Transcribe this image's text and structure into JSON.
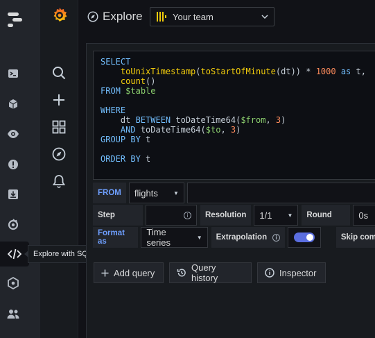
{
  "header": {
    "title": "Explore",
    "team_select": "Your team"
  },
  "tooltip": {
    "text": "Explore with SQL"
  },
  "editor": {
    "lines": [
      [
        {
          "t": "SELECT",
          "c": "kw"
        }
      ],
      [
        {
          "t": "    "
        },
        {
          "t": "toUnixTimestamp",
          "c": "fn"
        },
        {
          "t": "("
        },
        {
          "t": "toStartOfMinute",
          "c": "fn"
        },
        {
          "t": "(dt)) * "
        },
        {
          "t": "1000",
          "c": "num"
        },
        {
          "t": " "
        },
        {
          "t": "as",
          "c": "kw"
        },
        {
          "t": " t,"
        }
      ],
      [
        {
          "t": "    "
        },
        {
          "t": "count",
          "c": "fn"
        },
        {
          "t": "()"
        }
      ],
      [
        {
          "t": "FROM",
          "c": "kw"
        },
        {
          "t": " "
        },
        {
          "t": "$table",
          "c": "var"
        }
      ],
      [
        {
          "t": ""
        }
      ],
      [
        {
          "t": "WHERE",
          "c": "kw"
        }
      ],
      [
        {
          "t": "    dt "
        },
        {
          "t": "BETWEEN",
          "c": "kw"
        },
        {
          "t": " toDateTime64("
        },
        {
          "t": "$from",
          "c": "var"
        },
        {
          "t": ", "
        },
        {
          "t": "3",
          "c": "num"
        },
        {
          "t": ")"
        }
      ],
      [
        {
          "t": "    "
        },
        {
          "t": "AND",
          "c": "kw"
        },
        {
          "t": " toDateTime64("
        },
        {
          "t": "$to",
          "c": "var"
        },
        {
          "t": ", "
        },
        {
          "t": "3",
          "c": "num"
        },
        {
          "t": ")"
        }
      ],
      [
        {
          "t": "GROUP BY",
          "c": "kw"
        },
        {
          "t": " t"
        }
      ],
      [
        {
          "t": ""
        }
      ],
      [
        {
          "t": "ORDER BY",
          "c": "kw"
        },
        {
          "t": " t"
        }
      ]
    ]
  },
  "options": {
    "from_label": "FROM",
    "from_value": "flights",
    "step_label": "Step",
    "step_info": "i",
    "resolution_label": "Resolution",
    "resolution_value": "1/1",
    "round_label": "Round",
    "round_value": "0s",
    "format_label": "Format as",
    "format_value": "Time series",
    "extrapolation_label": "Extrapolation",
    "extrapolation_info": "i",
    "skip_label": "Skip comm"
  },
  "actions": {
    "add_query": "Add query",
    "query_history": "Query history",
    "inspector": "Inspector"
  },
  "colors": {
    "accent": "#6e9fff",
    "grafana_orange": "#f46800",
    "toggle": "#5b6ee0"
  },
  "icons": {
    "outer": [
      "app-logo-icon",
      "terminal-icon",
      "cube-icon",
      "eye-icon",
      "alert-icon",
      "download-icon",
      "grafana-icon",
      "code-icon",
      "hub-icon",
      "users-icon"
    ],
    "inner": [
      "search-icon",
      "plus-icon",
      "dashboards-icon",
      "compass-icon",
      "bell-icon"
    ]
  }
}
